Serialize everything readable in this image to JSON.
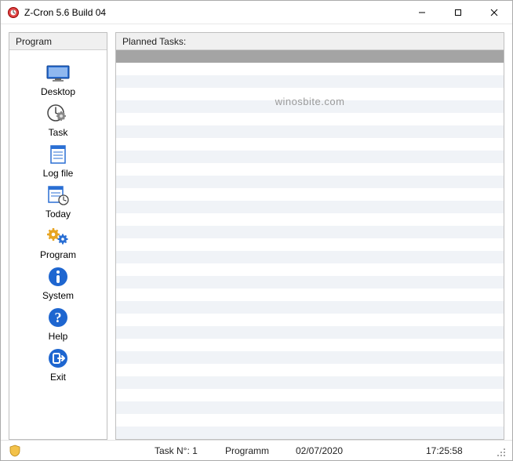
{
  "window": {
    "title": "Z-Cron 5.6 Build 04"
  },
  "sidebar": {
    "header": "Program",
    "items": [
      {
        "id": "desktop",
        "label": "Desktop"
      },
      {
        "id": "task",
        "label": "Task"
      },
      {
        "id": "logfile",
        "label": "Log file"
      },
      {
        "id": "today",
        "label": "Today"
      },
      {
        "id": "program",
        "label": "Program"
      },
      {
        "id": "system",
        "label": "System"
      },
      {
        "id": "help",
        "label": "Help"
      },
      {
        "id": "exit",
        "label": "Exit"
      }
    ]
  },
  "main": {
    "header": "Planned Tasks:",
    "watermark": "winosbite.com"
  },
  "status": {
    "task_no_label": "Task N°: 1",
    "program_label": "Programm",
    "date": "02/07/2020",
    "time": "17:25:58"
  },
  "colors": {
    "accent_blue": "#1e66d0",
    "row_alt": "#f0f3f7",
    "header_gray": "#a4a4a4"
  }
}
